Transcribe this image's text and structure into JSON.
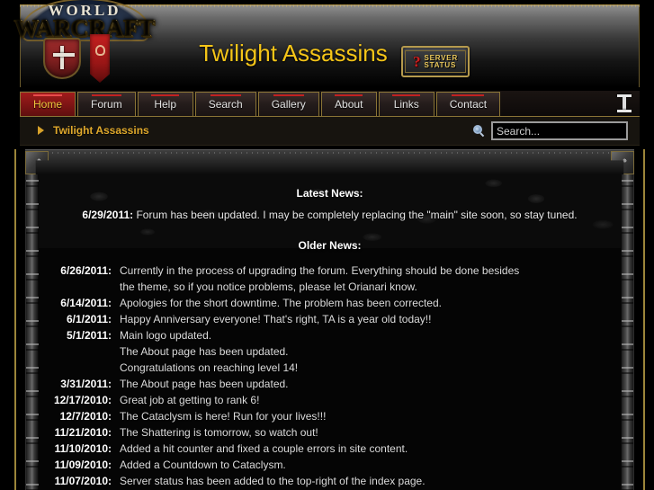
{
  "header": {
    "logo": {
      "word_top": "WORLD",
      "word_bottom": "WARCRAFT",
      "alt": "world-of-warcraft-logo"
    },
    "site_title": "Twilight Assassins",
    "server_status": {
      "line1": "SERVER",
      "line2": "STATUS",
      "glyph": "?"
    }
  },
  "nav": {
    "tabs": [
      {
        "label": "Home",
        "active": true
      },
      {
        "label": "Forum",
        "active": false
      },
      {
        "label": "Help",
        "active": false
      },
      {
        "label": "Search",
        "active": false
      },
      {
        "label": "Gallery",
        "active": false
      },
      {
        "label": "About",
        "active": false
      },
      {
        "label": "Links",
        "active": false
      },
      {
        "label": "Contact",
        "active": false
      }
    ]
  },
  "subbar": {
    "breadcrumb": "Twilight Assassins",
    "search": {
      "value": "",
      "placeholder": "Search..."
    }
  },
  "content": {
    "latest_heading": "Latest News:",
    "latest": {
      "date": "6/29/2011:",
      "text": "Forum has been updated. I may be completely replacing the \"main\" site soon, so stay tuned."
    },
    "older_heading": "Older News:",
    "older": [
      {
        "date": "6/26/2011:",
        "lines": [
          "Currently in the process of upgrading the forum. Everything should be done besides",
          "the theme, so if you notice problems, please let Orianari know."
        ]
      },
      {
        "date": "6/14/2011:",
        "lines": [
          "Apologies for the short downtime. The problem has been corrected."
        ]
      },
      {
        "date": "6/1/2011:",
        "lines": [
          "Happy Anniversary everyone! That's right, TA is a year old today!!"
        ]
      },
      {
        "date": "5/1/2011:",
        "lines": [
          "Main logo updated.",
          "The About page has been updated.",
          "Congratulations on reaching level 14!"
        ]
      },
      {
        "date": "3/31/2011:",
        "lines": [
          "The About page has been updated."
        ]
      },
      {
        "date": "12/17/2010:",
        "lines": [
          "Great job at getting to rank 6!"
        ]
      },
      {
        "date": "12/7/2010:",
        "lines": [
          "The Cataclysm is here! Run for your lives!!!"
        ]
      },
      {
        "date": "11/21/2010:",
        "lines": [
          "The Shattering is tomorrow, so watch out!"
        ]
      },
      {
        "date": "11/10/2010:",
        "lines": [
          "Added a hit counter and fixed a couple errors in site content."
        ]
      },
      {
        "date": "11/09/2010:",
        "lines": [
          "Added a Countdown to Cataclysm."
        ]
      },
      {
        "date": "11/07/2010:",
        "lines": [
          "Server status has been added to the top-right of the index page."
        ]
      }
    ]
  },
  "colors": {
    "gold": "#f5c518",
    "breadcrumb_gold": "#e0a92c",
    "active_tab_red": "#a01c1c",
    "tab_accent_red": "#c22121",
    "border_gold": "#8a7436"
  }
}
